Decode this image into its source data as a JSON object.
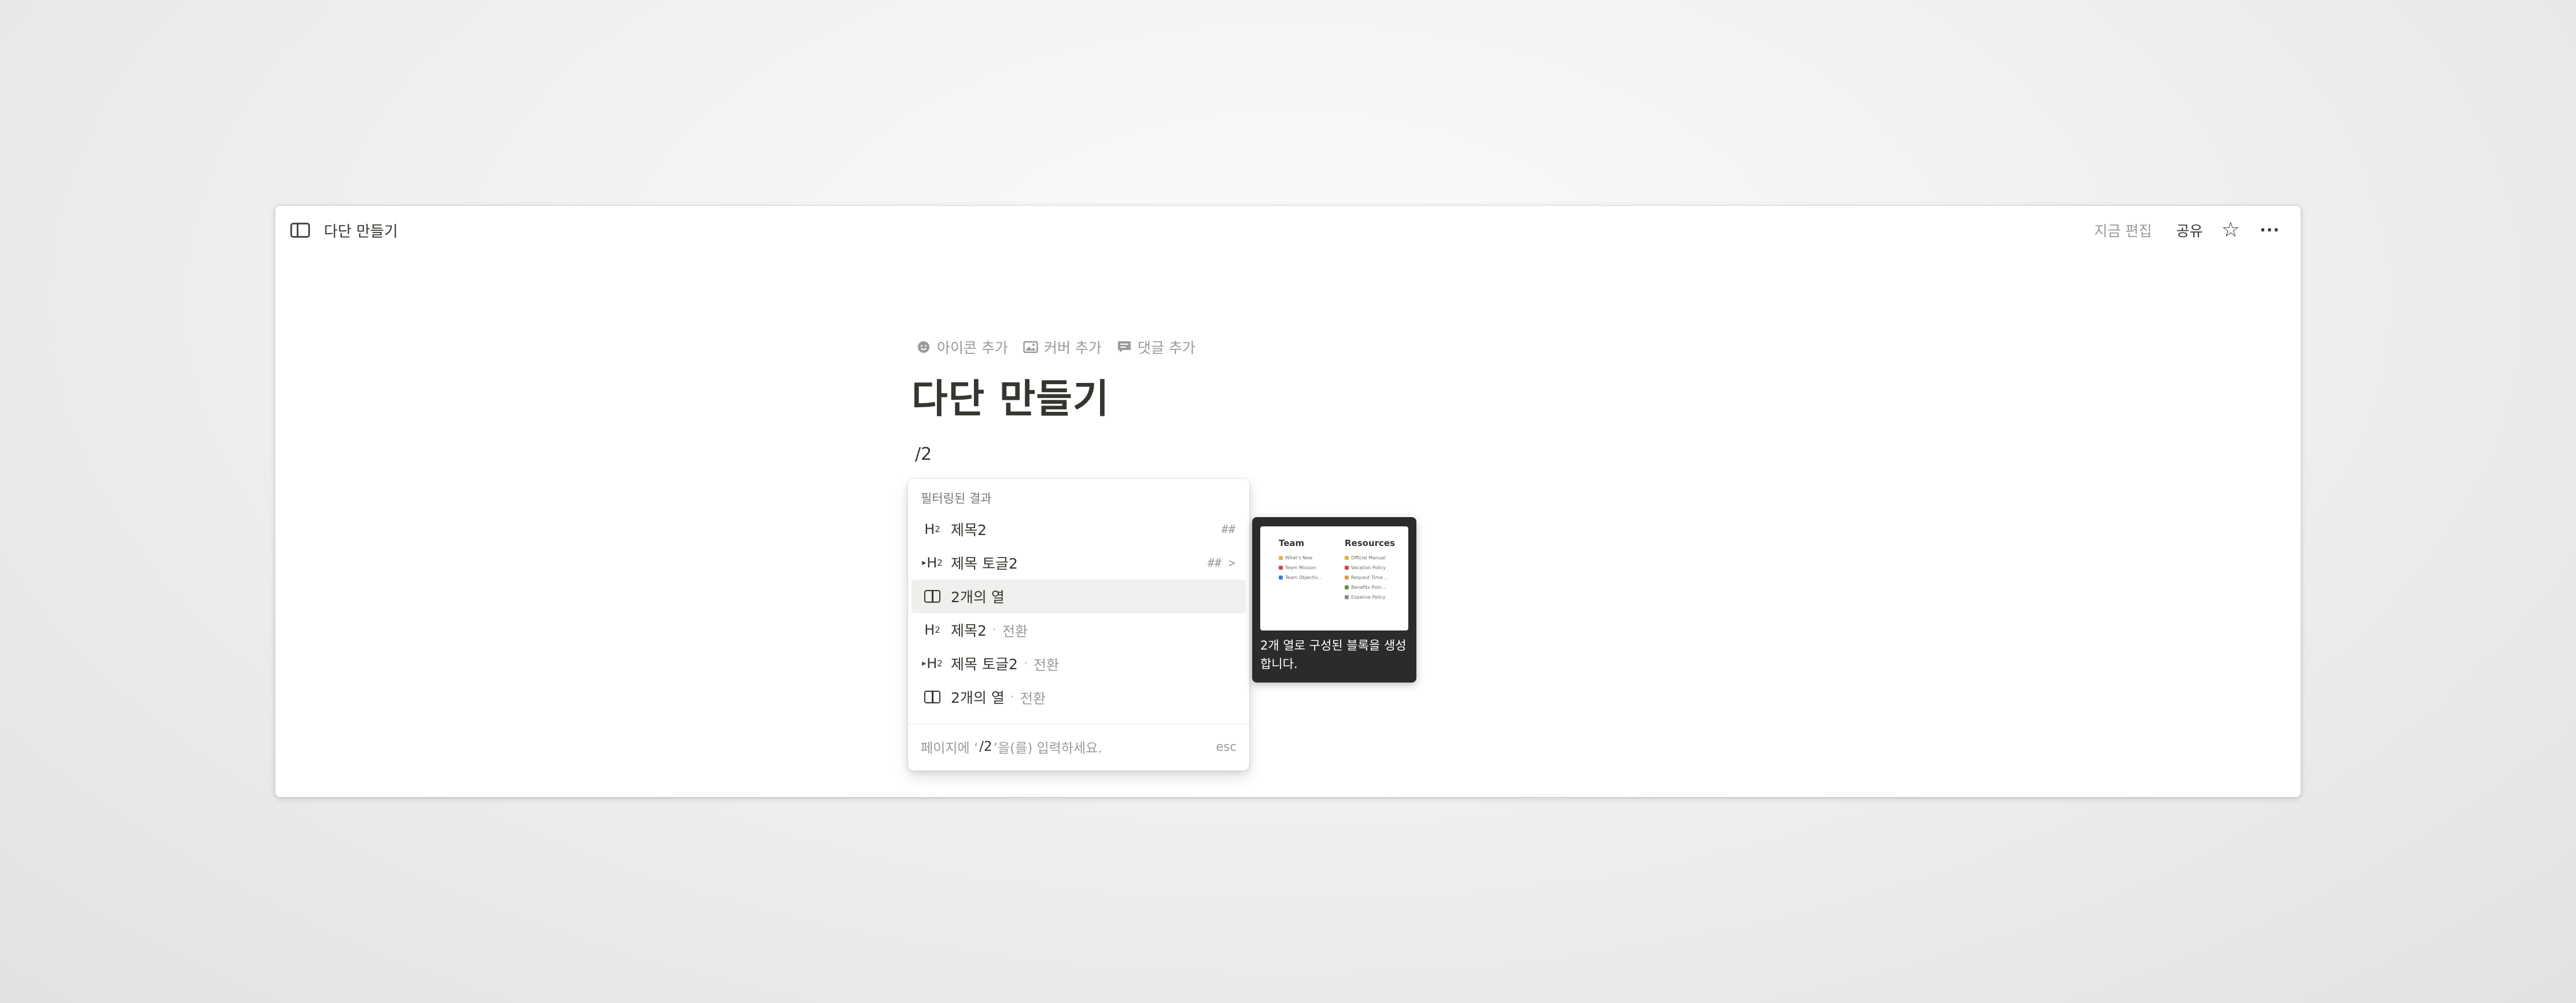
{
  "topbar": {
    "breadcrumb": "다단 만들기",
    "edited": "지금 편집",
    "share": "공유",
    "star_icon": "☆",
    "more_icon": "···"
  },
  "page": {
    "actions": [
      {
        "icon": "smiley-icon",
        "label": "아이콘 추가"
      },
      {
        "icon": "image-icon",
        "label": "커버 추가"
      },
      {
        "icon": "comment-icon",
        "label": "댓글 추가"
      }
    ],
    "title": "다단 만들기",
    "slash_text": "/2"
  },
  "menu": {
    "header": "필터링된 결과",
    "items": [
      {
        "icon": "heading-2-icon",
        "label": "제목2",
        "suffix": "",
        "shortcut": "##"
      },
      {
        "icon": "toggle-heading-2-icon",
        "label": "제목 토글2",
        "suffix": "",
        "shortcut": "## >"
      },
      {
        "icon": "columns-icon",
        "label": "2개의 열",
        "suffix": "",
        "shortcut": "",
        "selected": true
      },
      {
        "icon": "heading-2-icon",
        "label": "제목2",
        "suffix": "전환",
        "shortcut": ""
      },
      {
        "icon": "toggle-heading-2-icon",
        "label": "제목 토글2",
        "suffix": "전환",
        "shortcut": ""
      },
      {
        "icon": "columns-icon",
        "label": "2개의 열",
        "suffix": "전환",
        "shortcut": ""
      }
    ],
    "separator": "·",
    "footer": {
      "prefix": "페이지에 ‘",
      "query": "/2",
      "suffix": "’을(를) 입력하세요.",
      "esc": "esc"
    }
  },
  "preview": {
    "left_title": "Team",
    "left_items": [
      "What's New",
      "Team Mission",
      "Team Objectiv..."
    ],
    "right_title": "Resources",
    "right_items": [
      "Official Manual",
      "Vacation Policy",
      "Request Time...",
      "Benefits Polic...",
      "Expense Policy"
    ],
    "description": "2개 열로 구성된 블록을 생성합니다."
  },
  "colors": {
    "text": "#37352f",
    "muted": "#9b9a97",
    "selected_bg": "#efefee",
    "preview_bg": "#2b2b2b"
  }
}
